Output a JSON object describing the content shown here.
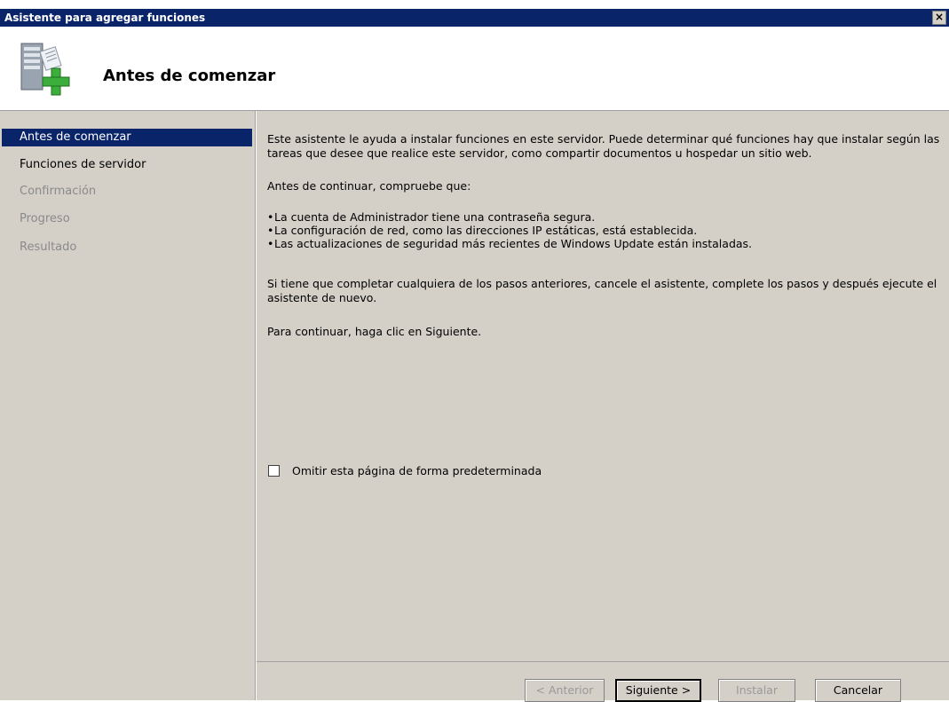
{
  "window": {
    "title": "Asistente para agregar funciones",
    "close_glyph": "×",
    "icon": "server-add-icon"
  },
  "header": {
    "title": "Antes de comenzar"
  },
  "sidebar": {
    "items": [
      {
        "label": "Antes de comenzar",
        "state": "active"
      },
      {
        "label": "Funciones de servidor",
        "state": "enabled"
      },
      {
        "label": "Confirmación",
        "state": "disabled"
      },
      {
        "label": "Progreso",
        "state": "disabled"
      },
      {
        "label": "Resultado",
        "state": "disabled"
      }
    ]
  },
  "content": {
    "intro": "Este asistente le ayuda a instalar funciones en este servidor. Puede determinar qué funciones hay que instalar según las tareas que desee que realice este servidor, como compartir documentos u hospedar un sitio web.",
    "before_continue": "Antes de continuar, compruebe que:",
    "checklist": [
      "La cuenta de Administrador tiene una contraseña segura.",
      "La configuración de red, como las direcciones IP estáticas, está establecida.",
      "Las actualizaciones de seguridad más recientes de Windows Update están instaladas."
    ],
    "if_needed": "Si tiene que completar cualquiera de los pasos anteriores, cancele el asistente, complete los pasos y después ejecute el asistente de nuevo.",
    "to_continue": "Para continuar, haga clic en Siguiente.",
    "skip_checkbox_label": "Omitir esta página de forma predeterminada",
    "skip_checked": false
  },
  "footer": {
    "previous_label": "< Anterior",
    "next_label": "Siguiente >",
    "install_label": "Instalar",
    "cancel_label": "Cancelar"
  },
  "colors": {
    "titlebar": "#0a246a",
    "panel": "#d4d0c8",
    "selection": "#0a246a",
    "disabled_text": "#8a8a8a"
  }
}
